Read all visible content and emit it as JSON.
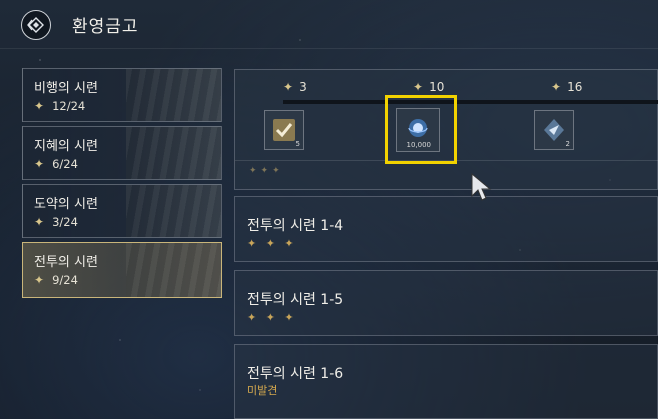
{
  "header": {
    "title": "환영금고",
    "back_icon": "diamond-back-icon"
  },
  "sidebar": {
    "items": [
      {
        "label": "비행의 시련",
        "progress": "12/24",
        "active": false
      },
      {
        "label": "지혜의 시련",
        "progress": "6/24",
        "active": false
      },
      {
        "label": "도약의 시련",
        "progress": "3/24",
        "active": false
      },
      {
        "label": "전투의 시련",
        "progress": "9/24",
        "active": true
      }
    ]
  },
  "rewards": {
    "milestones": [
      {
        "stars": "3",
        "item_icon": "check-chest-icon",
        "count": "5"
      },
      {
        "stars": "10",
        "item_icon": "blue-orb-icon",
        "count": "10,000",
        "highlighted": true
      },
      {
        "stars": "16",
        "item_icon": "crystal-emblem-icon",
        "count": "2"
      }
    ]
  },
  "stages": [
    {
      "name": "전투의 시련 1-4",
      "stars": "✦ ✦ ✦"
    },
    {
      "name": "전투의 시련 1-5",
      "stars": "✦ ✦ ✦"
    },
    {
      "name": "전투의 시련 1-6",
      "status": "미발견"
    }
  ],
  "colors": {
    "highlight": "#f2d200",
    "star_gold": "#d8c68c",
    "undiscovered": "#d4a84e"
  }
}
